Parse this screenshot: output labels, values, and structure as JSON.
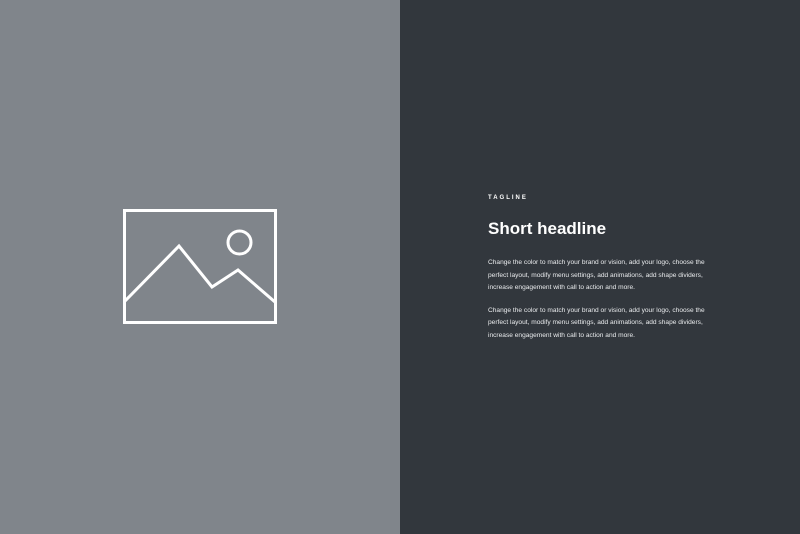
{
  "colors": {
    "media_background": "#80858b",
    "content_background": "#32373d",
    "text": "#ffffff",
    "placeholder_stroke": "#ffffff"
  },
  "media": {
    "icon": "image-placeholder-icon"
  },
  "content": {
    "tagline": "TAGLINE",
    "headline": "Short headline",
    "paragraph_1": "Change the color to match your brand or vision, add your logo, choose the perfect layout, modify menu settings, add animations, add shape dividers, increase engagement with call to action and more.",
    "paragraph_2": "Change the color to match your brand or vision, add your logo, choose the perfect layout, modify menu settings, add animations, add shape dividers, increase engagement with call to action and more."
  }
}
